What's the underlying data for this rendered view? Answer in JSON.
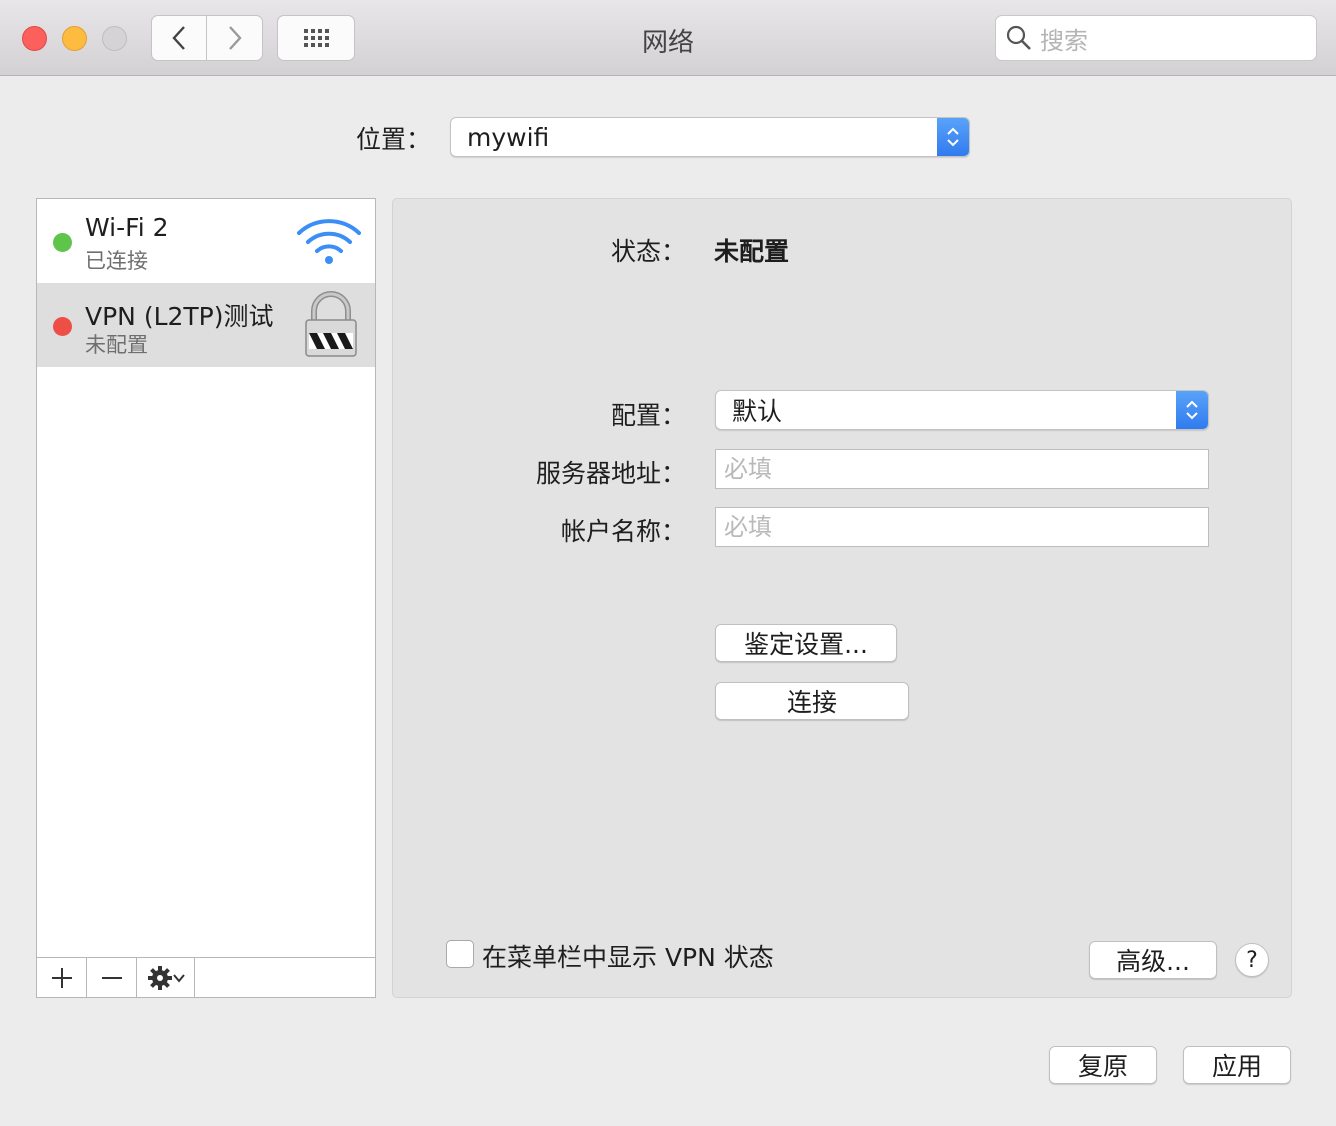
{
  "window": {
    "title": "网络",
    "search_placeholder": "搜索"
  },
  "location": {
    "label": "位置：",
    "value": "mywifi"
  },
  "services": [
    {
      "name": "Wi-Fi 2",
      "status": "已连接",
      "dot_color": "#5ec54a",
      "icon": "wifi-icon"
    },
    {
      "name": "VPN (L2TP)测试",
      "status": "未配置",
      "dot_color": "#ed4f47",
      "icon": "lock-icon",
      "selected": true
    }
  ],
  "sidebar_toolbar": {
    "add": "+",
    "remove": "—"
  },
  "detail": {
    "status_label": "状态：",
    "status_value": "未配置",
    "config_label": "配置：",
    "config_value": "默认",
    "server_label": "服务器地址：",
    "server_placeholder": "必填",
    "account_label": "帐户名称：",
    "account_placeholder": "必填",
    "auth_button": "鉴定设置...",
    "connect_button": "连接",
    "show_vpn_label": "在菜单栏中显示 VPN 状态",
    "advanced_button": "高级...",
    "help_button": "?"
  },
  "footer": {
    "revert_button": "复原",
    "apply_button": "应用"
  }
}
